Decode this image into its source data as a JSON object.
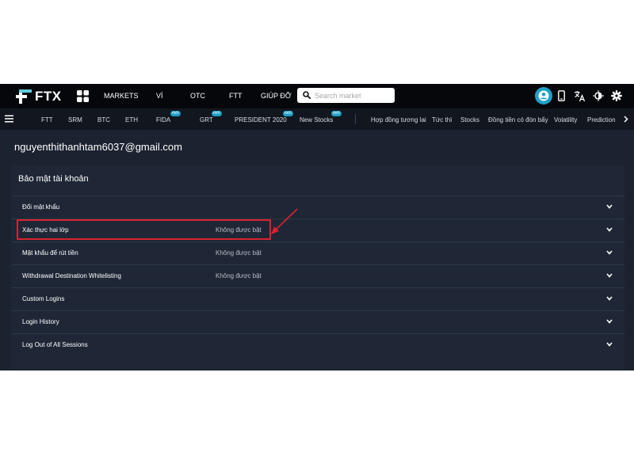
{
  "brand": {
    "name": "FTX",
    "accent": "#1ea1c9",
    "highlight_color": "#d8232f"
  },
  "topnav": {
    "items": [
      "MARKETS",
      "VÍ",
      "OTC",
      "FTT",
      "GIÚP ĐỠ"
    ],
    "search_placeholder": "Search market",
    "icons": [
      "grid-icon",
      "search-icon",
      "user-avatar-icon",
      "mobile-icon",
      "translate-icon",
      "theme-toggle-icon",
      "settings-gear-icon"
    ]
  },
  "marketbar": {
    "items": [
      {
        "label": "FTT",
        "badge": ""
      },
      {
        "label": "SRM",
        "badge": ""
      },
      {
        "label": "BTC",
        "badge": ""
      },
      {
        "label": "ETH",
        "badge": ""
      },
      {
        "label": "FIDA",
        "badge": "mới"
      },
      {
        "label": "GRT",
        "badge": "mới"
      },
      {
        "label": "PRESIDENT 2020",
        "badge": "mới"
      },
      {
        "label": "New Stocks",
        "badge": "mới"
      },
      {
        "label": "Hợp đồng tương lai",
        "badge": ""
      },
      {
        "label": "Tức thì",
        "badge": ""
      },
      {
        "label": "Stocks",
        "badge": ""
      },
      {
        "label": "Đồng tiền có đòn bẩy",
        "badge": ""
      },
      {
        "label": "Volatility",
        "badge": ""
      },
      {
        "label": "Prediction",
        "badge": ""
      }
    ]
  },
  "account": {
    "email": "nguyenthithanhtam6037@gmail.com",
    "section_title": "Bảo mật tài khoản",
    "rows": [
      {
        "label": "Đổi mật khẩu",
        "status": ""
      },
      {
        "label": "Xác thực hai lớp",
        "status": "Không được bật"
      },
      {
        "label": "Mật khẩu để rút tiền",
        "status": "Không được bật"
      },
      {
        "label": "Withdrawal Destination Whitelisting",
        "status": "Không được bật"
      },
      {
        "label": "Custom Logins",
        "status": ""
      },
      {
        "label": "Login History",
        "status": ""
      },
      {
        "label": "Log Out of All Sessions",
        "status": ""
      }
    ]
  }
}
